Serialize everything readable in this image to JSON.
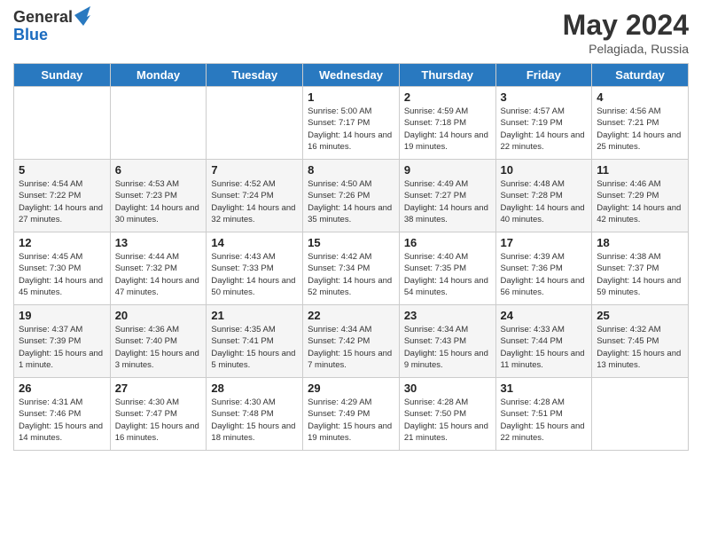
{
  "logo": {
    "general": "General",
    "blue": "Blue"
  },
  "title": {
    "month": "May 2024",
    "location": "Pelagiada, Russia"
  },
  "weekdays": [
    "Sunday",
    "Monday",
    "Tuesday",
    "Wednesday",
    "Thursday",
    "Friday",
    "Saturday"
  ],
  "rows": [
    [
      {
        "day": "",
        "info": ""
      },
      {
        "day": "",
        "info": ""
      },
      {
        "day": "",
        "info": ""
      },
      {
        "day": "1",
        "info": "Sunrise: 5:00 AM\nSunset: 7:17 PM\nDaylight: 14 hours\nand 16 minutes."
      },
      {
        "day": "2",
        "info": "Sunrise: 4:59 AM\nSunset: 7:18 PM\nDaylight: 14 hours\nand 19 minutes."
      },
      {
        "day": "3",
        "info": "Sunrise: 4:57 AM\nSunset: 7:19 PM\nDaylight: 14 hours\nand 22 minutes."
      },
      {
        "day": "4",
        "info": "Sunrise: 4:56 AM\nSunset: 7:21 PM\nDaylight: 14 hours\nand 25 minutes."
      }
    ],
    [
      {
        "day": "5",
        "info": "Sunrise: 4:54 AM\nSunset: 7:22 PM\nDaylight: 14 hours\nand 27 minutes."
      },
      {
        "day": "6",
        "info": "Sunrise: 4:53 AM\nSunset: 7:23 PM\nDaylight: 14 hours\nand 30 minutes."
      },
      {
        "day": "7",
        "info": "Sunrise: 4:52 AM\nSunset: 7:24 PM\nDaylight: 14 hours\nand 32 minutes."
      },
      {
        "day": "8",
        "info": "Sunrise: 4:50 AM\nSunset: 7:26 PM\nDaylight: 14 hours\nand 35 minutes."
      },
      {
        "day": "9",
        "info": "Sunrise: 4:49 AM\nSunset: 7:27 PM\nDaylight: 14 hours\nand 38 minutes."
      },
      {
        "day": "10",
        "info": "Sunrise: 4:48 AM\nSunset: 7:28 PM\nDaylight: 14 hours\nand 40 minutes."
      },
      {
        "day": "11",
        "info": "Sunrise: 4:46 AM\nSunset: 7:29 PM\nDaylight: 14 hours\nand 42 minutes."
      }
    ],
    [
      {
        "day": "12",
        "info": "Sunrise: 4:45 AM\nSunset: 7:30 PM\nDaylight: 14 hours\nand 45 minutes."
      },
      {
        "day": "13",
        "info": "Sunrise: 4:44 AM\nSunset: 7:32 PM\nDaylight: 14 hours\nand 47 minutes."
      },
      {
        "day": "14",
        "info": "Sunrise: 4:43 AM\nSunset: 7:33 PM\nDaylight: 14 hours\nand 50 minutes."
      },
      {
        "day": "15",
        "info": "Sunrise: 4:42 AM\nSunset: 7:34 PM\nDaylight: 14 hours\nand 52 minutes."
      },
      {
        "day": "16",
        "info": "Sunrise: 4:40 AM\nSunset: 7:35 PM\nDaylight: 14 hours\nand 54 minutes."
      },
      {
        "day": "17",
        "info": "Sunrise: 4:39 AM\nSunset: 7:36 PM\nDaylight: 14 hours\nand 56 minutes."
      },
      {
        "day": "18",
        "info": "Sunrise: 4:38 AM\nSunset: 7:37 PM\nDaylight: 14 hours\nand 59 minutes."
      }
    ],
    [
      {
        "day": "19",
        "info": "Sunrise: 4:37 AM\nSunset: 7:39 PM\nDaylight: 15 hours\nand 1 minute."
      },
      {
        "day": "20",
        "info": "Sunrise: 4:36 AM\nSunset: 7:40 PM\nDaylight: 15 hours\nand 3 minutes."
      },
      {
        "day": "21",
        "info": "Sunrise: 4:35 AM\nSunset: 7:41 PM\nDaylight: 15 hours\nand 5 minutes."
      },
      {
        "day": "22",
        "info": "Sunrise: 4:34 AM\nSunset: 7:42 PM\nDaylight: 15 hours\nand 7 minutes."
      },
      {
        "day": "23",
        "info": "Sunrise: 4:34 AM\nSunset: 7:43 PM\nDaylight: 15 hours\nand 9 minutes."
      },
      {
        "day": "24",
        "info": "Sunrise: 4:33 AM\nSunset: 7:44 PM\nDaylight: 15 hours\nand 11 minutes."
      },
      {
        "day": "25",
        "info": "Sunrise: 4:32 AM\nSunset: 7:45 PM\nDaylight: 15 hours\nand 13 minutes."
      }
    ],
    [
      {
        "day": "26",
        "info": "Sunrise: 4:31 AM\nSunset: 7:46 PM\nDaylight: 15 hours\nand 14 minutes."
      },
      {
        "day": "27",
        "info": "Sunrise: 4:30 AM\nSunset: 7:47 PM\nDaylight: 15 hours\nand 16 minutes."
      },
      {
        "day": "28",
        "info": "Sunrise: 4:30 AM\nSunset: 7:48 PM\nDaylight: 15 hours\nand 18 minutes."
      },
      {
        "day": "29",
        "info": "Sunrise: 4:29 AM\nSunset: 7:49 PM\nDaylight: 15 hours\nand 19 minutes."
      },
      {
        "day": "30",
        "info": "Sunrise: 4:28 AM\nSunset: 7:50 PM\nDaylight: 15 hours\nand 21 minutes."
      },
      {
        "day": "31",
        "info": "Sunrise: 4:28 AM\nSunset: 7:51 PM\nDaylight: 15 hours\nand 22 minutes."
      },
      {
        "day": "",
        "info": ""
      }
    ]
  ]
}
